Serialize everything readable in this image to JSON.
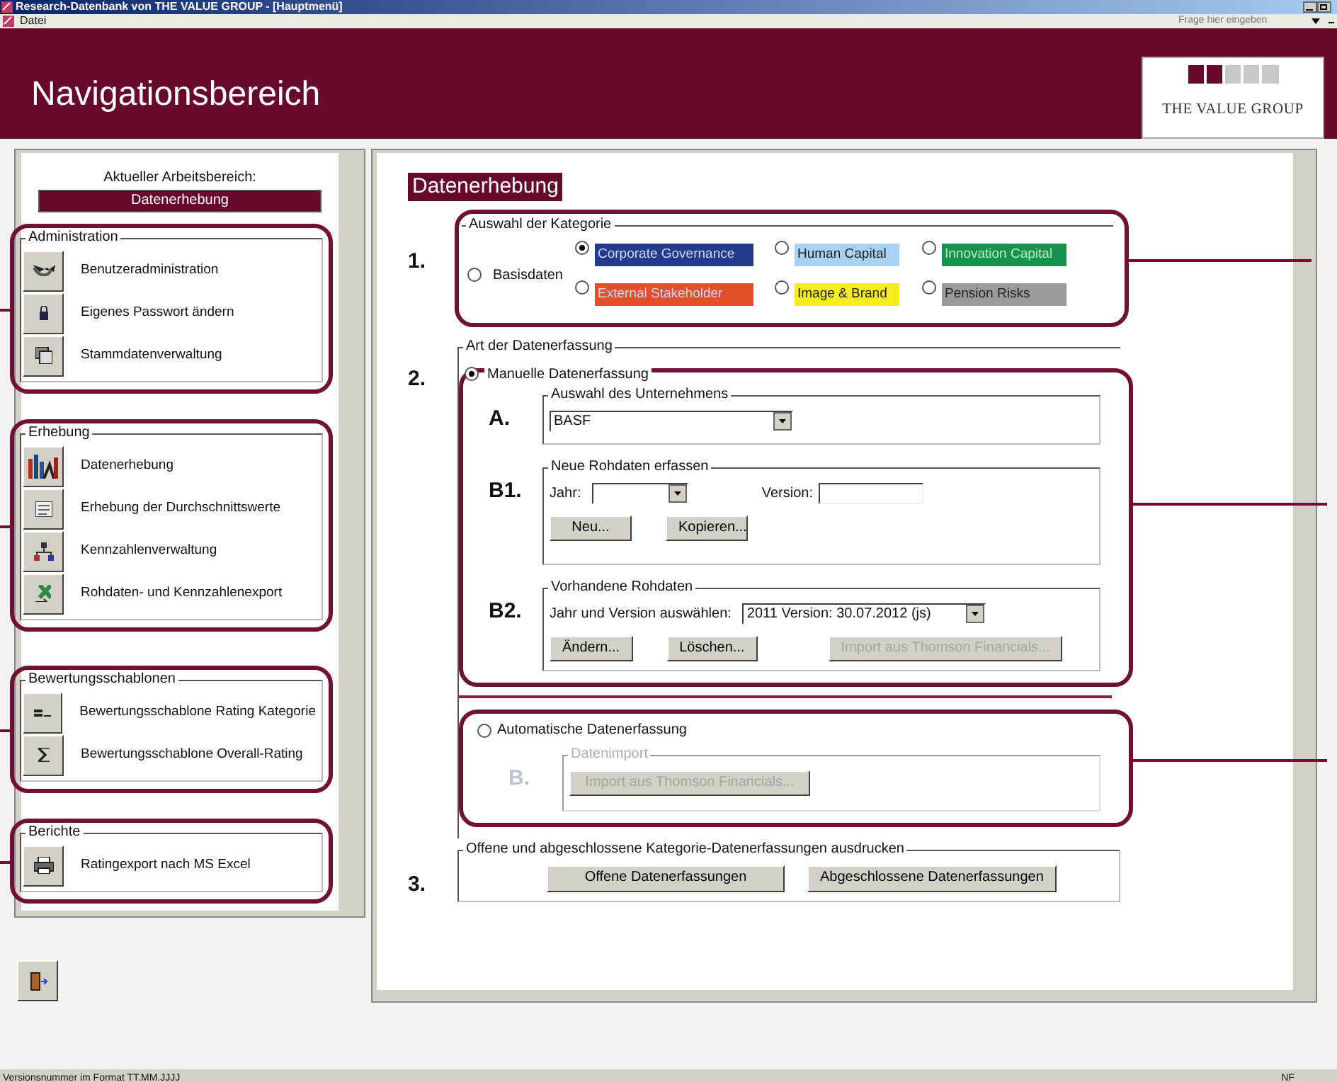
{
  "window": {
    "title": "Research-Datenbank von THE VALUE GROUP - [Hauptmenü]"
  },
  "menu": {
    "items": [
      "Datei"
    ],
    "help_placeholder": "Frage hier eingeben"
  },
  "header": {
    "title": "Navigationsbereich",
    "logo_text": "THE VALUE GROUP"
  },
  "sidebar": {
    "workspace_label": "Aktueller Arbeitsbereich:",
    "workspace_value": "Datenerhebung",
    "groups": [
      {
        "title": "Administration",
        "items": [
          "Benutzeradministration",
          "Eigenes Passwort ändern",
          "Stammdatenverwaltung"
        ]
      },
      {
        "title": "Erhebung",
        "items": [
          "Datenerhebung",
          "Erhebung der Durchschnittswerte",
          "Kennzahlenverwaltung",
          "Rohdaten- und Kennzahlenexport"
        ]
      },
      {
        "title": "Bewertungsschablonen",
        "items": [
          "Bewertungsschablone Rating Kategorie",
          "Bewertungsschablone Overall-Rating"
        ]
      },
      {
        "title": "Berichte",
        "items": [
          "Ratingexport nach MS Excel"
        ]
      }
    ]
  },
  "main": {
    "heading": "Datenerhebung",
    "section_1": {
      "number": "1.",
      "legend": "Auswahl der Kategorie",
      "base": {
        "label": "Basisdaten",
        "selected": false
      },
      "categories": [
        {
          "label": "Corporate Governance",
          "selected": true,
          "color": "#243a8c"
        },
        {
          "label": "Human Capital",
          "selected": false,
          "color": "#a9d1f2"
        },
        {
          "label": "Innovation Capital",
          "selected": false,
          "color": "#17924f"
        },
        {
          "label": "External Stakeholder",
          "selected": false,
          "color": "#e2502a"
        },
        {
          "label": "Image & Brand",
          "selected": false,
          "color": "#f7ec1e"
        },
        {
          "label": "Pension Risks",
          "selected": false,
          "color": "#9a9a9a"
        }
      ]
    },
    "section_2": {
      "number": "2.",
      "legend": "Art der Datenerfassung",
      "manual": {
        "label": "Manuelle Datenerfassung",
        "selected": true,
        "a": {
          "mark": "A.",
          "legend": "Auswahl des Unternehmens",
          "company": "BASF"
        },
        "b1": {
          "mark": "B1.",
          "legend": "Neue Rohdaten erfassen",
          "year_label": "Jahr:",
          "version_label": "Version:",
          "buttons": [
            {
              "label": "Neu...",
              "disabled": false
            },
            {
              "label": "Kopieren...",
              "disabled": false
            }
          ]
        },
        "b2": {
          "mark": "B2.",
          "legend": "Vorhandene Rohdaten",
          "select_label": "Jahr und Version auswählen:",
          "selection": "2011 Version: 30.07.2012 (js)",
          "buttons": [
            {
              "label": "Ändern...",
              "disabled": false
            },
            {
              "label": "Löschen...",
              "disabled": false
            },
            {
              "label": "Import aus Thomson Financials...",
              "disabled": true
            }
          ]
        }
      },
      "automatic": {
        "label": "Automatische Datenerfassung",
        "selected": false,
        "b": {
          "mark": "B.",
          "legend": "Datenimport",
          "disabled": true,
          "buttons": [
            {
              "label": "Import aus Thomson Financials...",
              "disabled": true
            }
          ]
        }
      }
    },
    "section_3": {
      "number": "3.",
      "legend": "Offene und abgeschlossene Kategorie-Datenerfassungen ausdrucken",
      "buttons": [
        {
          "label": "Offene Datenerfassungen",
          "disabled": false
        },
        {
          "label": "Abgeschlossene Datenerfassungen",
          "disabled": false
        }
      ]
    }
  },
  "status_bar": {
    "left": "Versionsnummer im Format TT.MM.JJJJ",
    "right": "NF"
  }
}
